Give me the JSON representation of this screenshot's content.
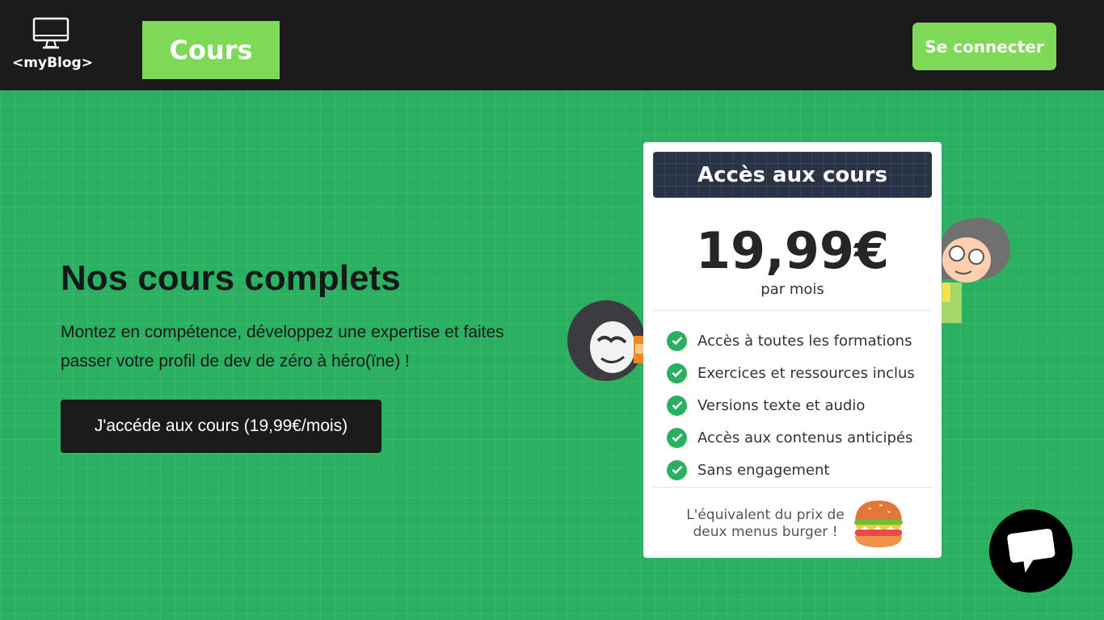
{
  "header": {
    "logo_text": "<myBlog>",
    "logo_icon": "monitor-icon",
    "nav_cours": "Cours",
    "login_label": "Se connecter"
  },
  "hero": {
    "title": "Nos cours complets",
    "subtitle": "Montez en compétence, développez une expertise et faites passer votre profil de dev de zéro à héro(ïne) !",
    "cta_label": "J'accéde aux cours (19,99€/mois)"
  },
  "pricing": {
    "heading": "Accès aux cours",
    "price": "19,99€",
    "period": "par mois",
    "features": [
      "Accès à toutes les formations",
      "Exercices et ressources inclus",
      "Versions texte et audio",
      "Accès aux contenus anticipés",
      "Sans engagement"
    ],
    "footnote": "L'équivalent du prix de deux menus burger !",
    "footnote_icon": "burger-icon"
  },
  "chat": {
    "icon": "chat-bubble-icon"
  },
  "colors": {
    "header_bg": "#1c1b1c",
    "accent_green": "#7ed957",
    "hero_bg": "#2bb061",
    "card_head_bg": "#283345"
  }
}
